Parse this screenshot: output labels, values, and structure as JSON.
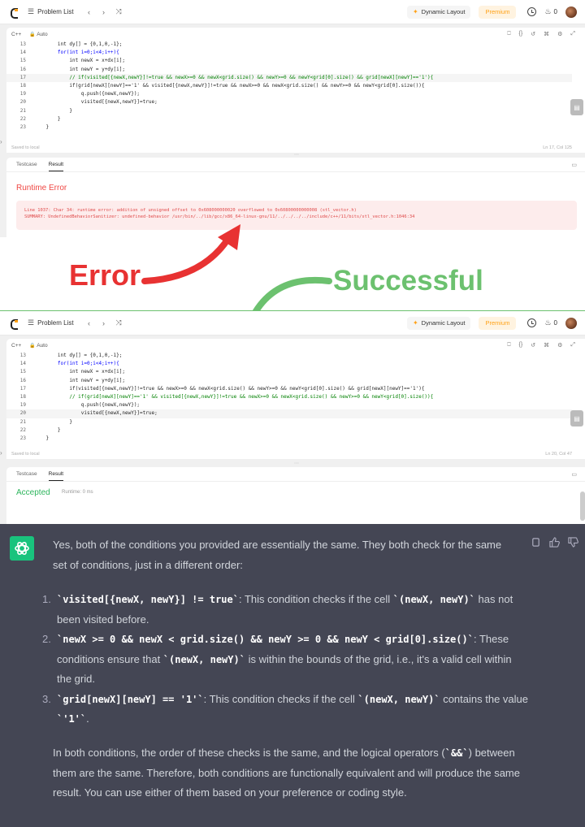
{
  "top": {
    "nav": {
      "problem_list": "Problem List",
      "dynamic_layout": "Dynamic Layout",
      "premium": "Premium",
      "streak": "0"
    },
    "editor": {
      "language": "C++",
      "mode": "Auto",
      "lines": [
        {
          "n": "13",
          "text": "        int dy[] = {0,1,0,-1};"
        },
        {
          "n": "14",
          "text": "        for(int i=0;i<4;i++){"
        },
        {
          "n": "15",
          "text": "            int newX = x+dx[i];"
        },
        {
          "n": "16",
          "text": "            int newY = y+dy[i];"
        },
        {
          "n": "17",
          "text": "            // if(visited[{newX,newY}]!=true && newX>=0 && newX<grid.size() && newY>=0 && newY<grid[0].size() && grid[newX][newY]=='1'){"
        },
        {
          "n": "18",
          "text": "            if(grid[newX][newY]=='1' && visited[{newX,newY}]!=true && newX>=0 && newX<grid.size() && newY>=0 && newY<grid[0].size()){"
        },
        {
          "n": "19",
          "text": "                q.push({newX,newY});"
        },
        {
          "n": "20",
          "text": "                visited[{newX,newY}]=true;"
        },
        {
          "n": "21",
          "text": "            }"
        },
        {
          "n": "22",
          "text": "        }"
        },
        {
          "n": "23",
          "text": "    }"
        }
      ],
      "status": "Saved to local",
      "position": "Ln 17, Col 125"
    },
    "result": {
      "tab_testcase": "Testcase",
      "tab_result": "Result",
      "title": "Runtime Error",
      "error_line1": "Line 1037: Char 34: runtime error: addition of unsigned offset to 0x608000000020 overflowed to 0x60800000000008 (stl_vector.h)",
      "error_line2": "SUMMARY: UndefinedBehaviorSanitizer: undefined-behavior /usr/bin/../lib/gcc/x86_64-linux-gnu/11/../../../../include/c++/11/bits/stl_vector.h:1046:34"
    }
  },
  "labels": {
    "error": "Error",
    "successful": "Successful"
  },
  "bottom": {
    "nav": {
      "problem_list": "Problem List",
      "dynamic_layout": "Dynamic Layout",
      "premium": "Premium",
      "streak": "0"
    },
    "editor": {
      "language": "C++",
      "mode": "Auto",
      "lines": [
        {
          "n": "13",
          "text": "        int dy[] = {0,1,0,-1};"
        },
        {
          "n": "14",
          "text": "        for(int i=0;i<4;i++){"
        },
        {
          "n": "15",
          "text": "            int newX = x+dx[i];"
        },
        {
          "n": "16",
          "text": "            int newY = y+dy[i];"
        },
        {
          "n": "17",
          "text": "            if(visited[{newX,newY}]!=true && newX>=0 && newX<grid.size() && newY>=0 && newY<grid[0].size() && grid[newX][newY]=='1'){"
        },
        {
          "n": "18",
          "text": "            // if(grid[newX][newY]=='1' && visited[{newX,newY}]!=true && newX>=0 && newX<grid.size() && newY>=0 && newY<grid[0].size()){"
        },
        {
          "n": "19",
          "text": "                q.push({newX,newY});"
        },
        {
          "n": "20",
          "text": "                visited[{newX,newY}]=true;"
        },
        {
          "n": "21",
          "text": "            }"
        },
        {
          "n": "22",
          "text": "        }"
        },
        {
          "n": "23",
          "text": "    }"
        }
      ],
      "status": "Saved to local",
      "position": "Ln 20, Col 47"
    },
    "result": {
      "tab_testcase": "Testcase",
      "tab_result": "Result",
      "title": "Accepted",
      "runtime": "Runtime: 0 ms"
    }
  },
  "chat": {
    "intro": "Yes, both of the conditions you provided are essentially the same. They both check for the same set of conditions, just in a different order:",
    "items": [
      {
        "num": "1.",
        "code": "`visited[{newX, newY}] != true`",
        "text": ": This condition checks if the cell ",
        "code2": "`(newX, newY)`",
        "text2": " has not been visited before."
      },
      {
        "num": "2.",
        "code": "`newX >= 0 && newX < grid.size() && newY >= 0 && newY < grid[0].size()`",
        "text": ": These conditions ensure that ",
        "code2": "`(newX, newY)`",
        "text2": " is within the bounds of the grid, i.e., it's a valid cell within the grid."
      },
      {
        "num": "3.",
        "code": "`grid[newX][newY] == '1'`",
        "text": ": This condition checks if the cell ",
        "code2": "`(newX, newY)`",
        "text2": " contains the value ",
        "code3": "`'1'`",
        "text3": "."
      }
    ],
    "conclusion_a": "In both conditions, the order of these checks is the same, and the logical operators (",
    "conclusion_code": "`&&`",
    "conclusion_b": ") between them are the same. Therefore, both conditions are functionally equivalent and will produce the same result. You can use either of them based on your preference or coding style."
  },
  "colors": {
    "error_red": "#e83232",
    "success_green": "#6cc16f",
    "chat_bg": "#444654",
    "gpt_green": "#19c37d"
  },
  "icons": [
    "leetcode-logo-icon",
    "list-icon",
    "chevron-left-icon",
    "chevron-right-icon",
    "shuffle-icon",
    "sparkle-icon",
    "alarm-icon",
    "flame-icon",
    "lock-icon",
    "copy-icon",
    "thumbs-up-icon",
    "thumbs-down-icon",
    "openai-logo-icon"
  ]
}
